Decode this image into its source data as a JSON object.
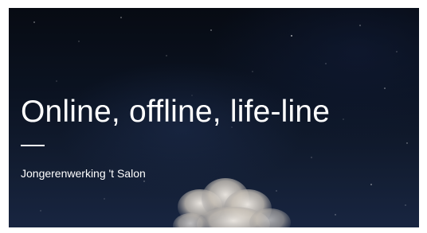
{
  "hero": {
    "title": "Online, offline, life-line",
    "subtitle": "Jongerenwerking 't Salon"
  },
  "colors": {
    "background": "#0b1322",
    "text": "#ffffff",
    "page": "#ffffff"
  }
}
